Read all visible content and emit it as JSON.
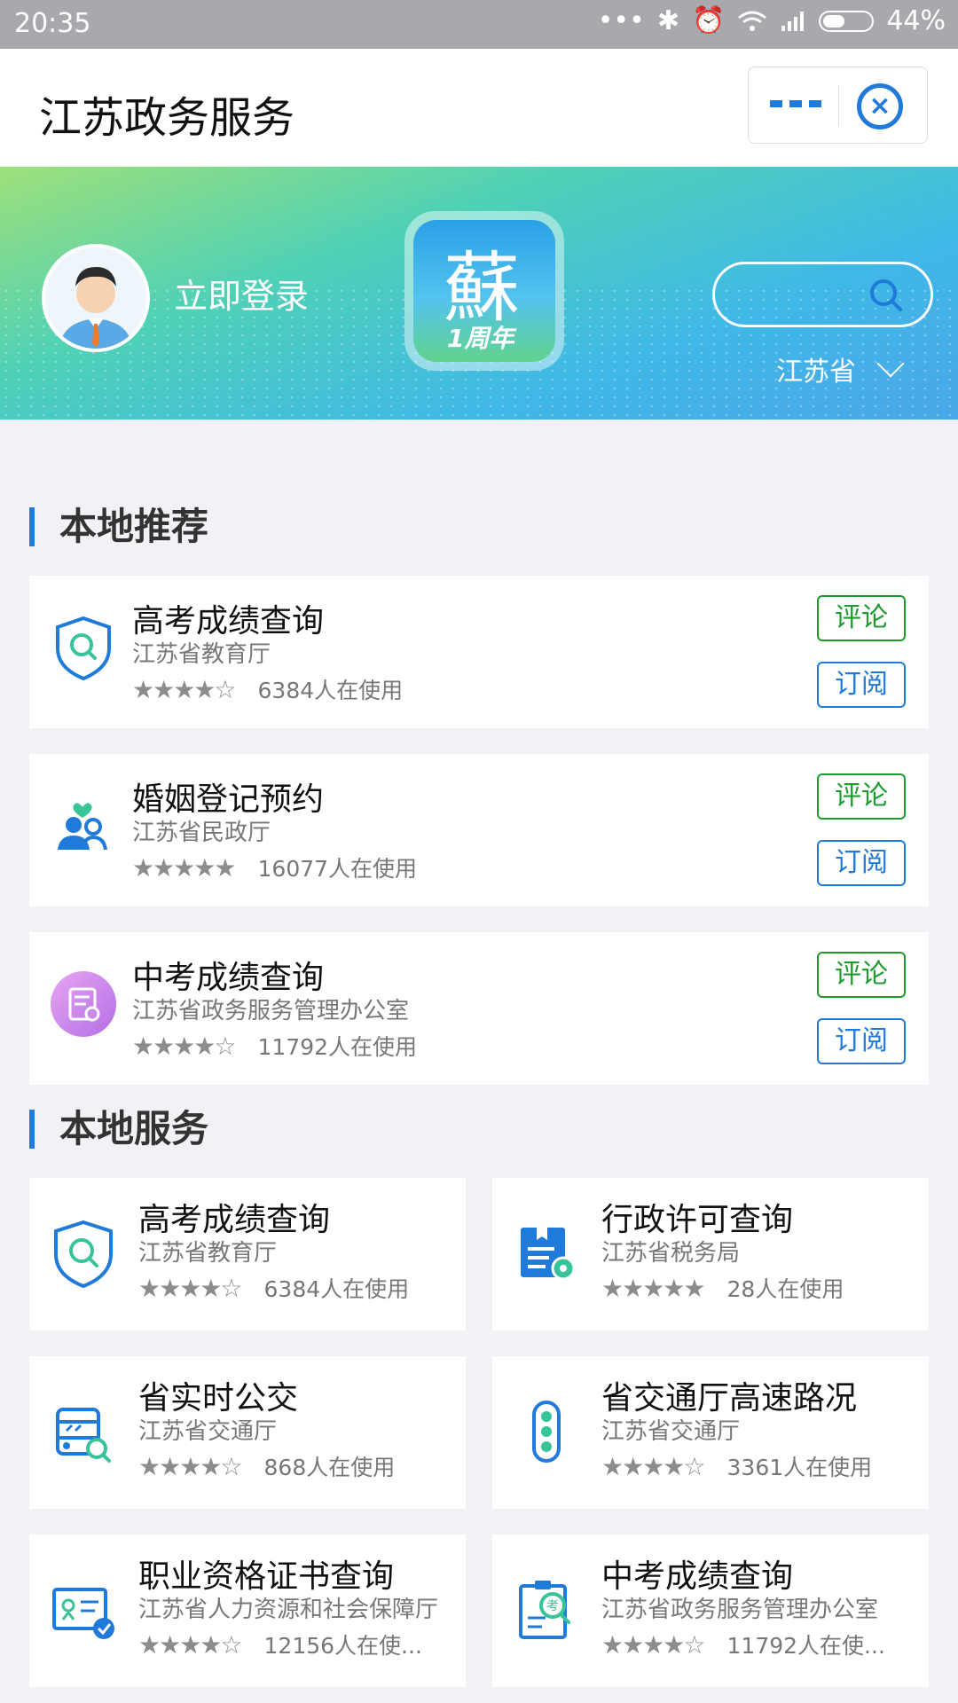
{
  "status_bar": {
    "time": "20:35",
    "battery": "44%"
  },
  "header": {
    "title": "江苏政务服务"
  },
  "banner": {
    "login_label": "立即登录",
    "logo_text": "蘇",
    "logo_badge": "1周年",
    "region": "江苏省"
  },
  "sections": {
    "recommend_title": "本地推荐",
    "services_title": "本地服务"
  },
  "recommend": [
    {
      "name": "高考成绩查询",
      "org": "江苏省教育厅",
      "stars": "★★★★☆",
      "rating": 4,
      "usage": "6384人在使用",
      "comment": "评论",
      "subscribe": "订阅"
    },
    {
      "name": "婚姻登记预约",
      "org": "江苏省民政厅",
      "stars": "★★★★★",
      "rating": 5,
      "usage": "16077人在使用",
      "comment": "评论",
      "subscribe": "订阅"
    },
    {
      "name": "中考成绩查询",
      "org": "江苏省政务服务管理办公室",
      "stars": "★★★★☆",
      "rating": 4,
      "usage": "11792人在使用",
      "comment": "评论",
      "subscribe": "订阅"
    }
  ],
  "services": [
    {
      "name": "高考成绩查询",
      "org": "江苏省教育厅",
      "stars": "★★★★☆",
      "rating": 4,
      "usage": "6384人在使用"
    },
    {
      "name": "行政许可查询",
      "org": "江苏省税务局",
      "stars": "★★★★★",
      "rating": 5,
      "usage": "28人在使用"
    },
    {
      "name": "省实时公交",
      "org": "江苏省交通厅",
      "stars": "★★★★☆",
      "rating": 4,
      "usage": "868人在使用"
    },
    {
      "name": "省交通厅高速路况",
      "org": "江苏省交通厅",
      "stars": "★★★★☆",
      "rating": 4,
      "usage": "3361人在使用"
    },
    {
      "name": "职业资格证书查询",
      "org": "江苏省人力资源和社会保障厅",
      "stars": "★★★★☆",
      "rating": 4,
      "usage": "12156人在使..."
    },
    {
      "name": "中考成绩查询",
      "org": "江苏省政务服务管理办公室",
      "stars": "★★★★☆",
      "rating": 4,
      "usage": "11792人在使..."
    }
  ],
  "colors": {
    "accent": "#1f7ad9",
    "comment_green": "#1d9b30",
    "star_gray": "#8c8c8c"
  }
}
